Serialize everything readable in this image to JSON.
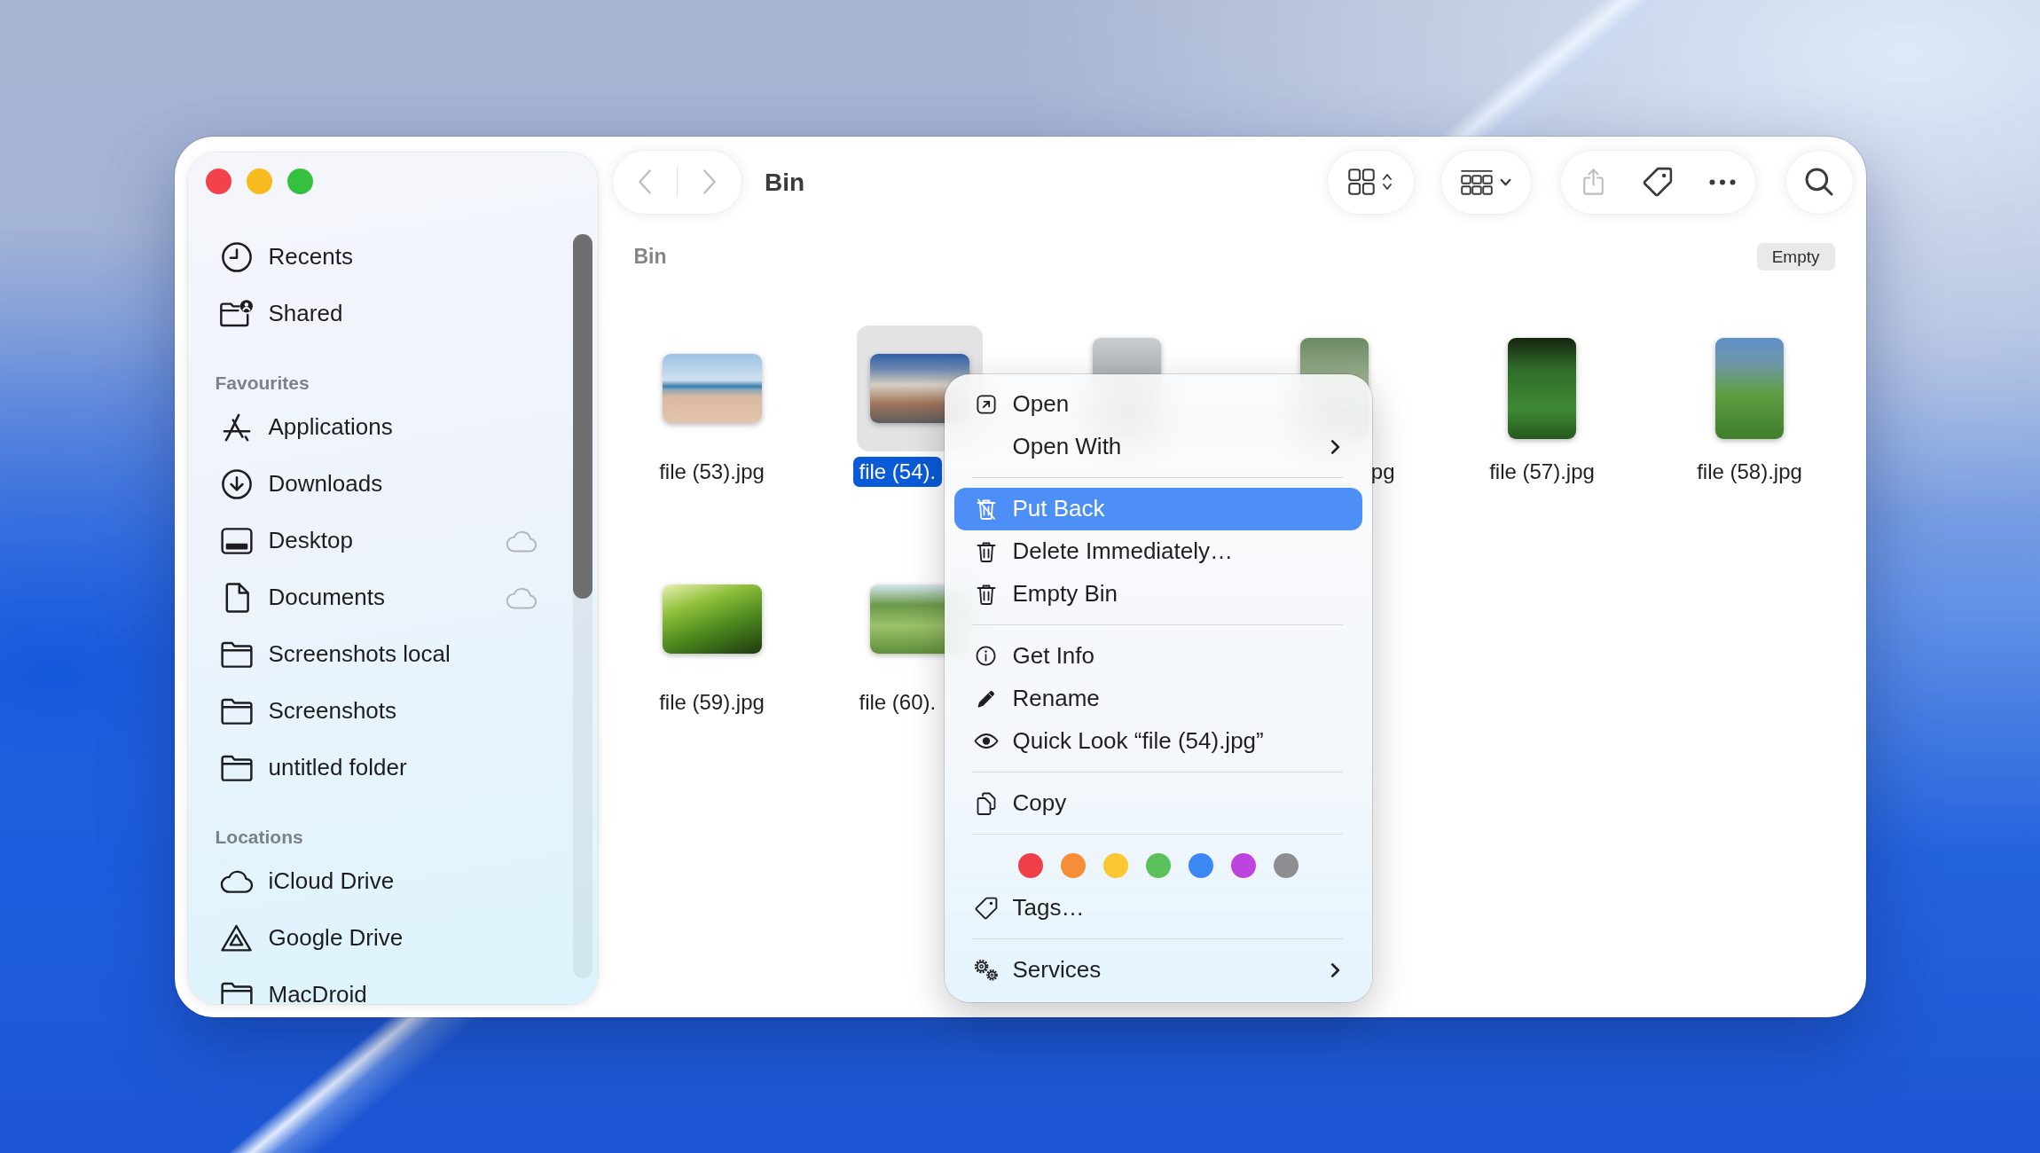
{
  "sidebar": {
    "groups": [
      {
        "items": [
          {
            "label": "Recents",
            "selected": false,
            "cloud": false
          },
          {
            "label": "Shared",
            "selected": false,
            "cloud": false
          }
        ]
      },
      {
        "heading": "Favourites",
        "items": [
          {
            "label": "Applications",
            "selected": false,
            "cloud": false
          },
          {
            "label": "Downloads",
            "selected": false,
            "cloud": false
          },
          {
            "label": "Desktop",
            "selected": false,
            "cloud": true
          },
          {
            "label": "Documents",
            "selected": false,
            "cloud": true
          },
          {
            "label": "Screenshots local",
            "selected": false,
            "cloud": false
          },
          {
            "label": "Screenshots",
            "selected": false,
            "cloud": false
          },
          {
            "label": "untitled folder",
            "selected": false,
            "cloud": false
          }
        ]
      },
      {
        "heading": "Locations",
        "items": [
          {
            "label": "iCloud Drive",
            "selected": false,
            "cloud": false
          },
          {
            "label": "Google Drive",
            "selected": false,
            "cloud": false
          },
          {
            "label": "MacDroid",
            "selected": false,
            "cloud": false
          }
        ]
      }
    ]
  },
  "toolbar": {
    "nav": [
      {
        "disabled": true
      },
      {
        "disabled": true
      }
    ],
    "title": "Bin",
    "tools": [
      {
        "disabled": false
      },
      {
        "disabled": false
      },
      {
        "disabled": true
      },
      {
        "disabled": false
      },
      {
        "disabled": false
      },
      {
        "disabled": false
      }
    ]
  },
  "path_bar": {
    "title": "Bin",
    "button": "Empty"
  },
  "files": [
    {
      "kind": "landscape",
      "label": "file (53).jpg",
      "cut_start": false,
      "cut_end": false,
      "selected": false
    },
    {
      "kind": "landscape",
      "label": "file (54).",
      "cut_start": false,
      "cut_end": true,
      "selected": true
    },
    {
      "kind": "portrait",
      "selected": false
    },
    {
      "kind": "portrait",
      "label": "pg",
      "cut_start": true,
      "cut_end": false,
      "selected": false
    },
    {
      "kind": "portrait",
      "label": "file (57).jpg",
      "cut_start": false,
      "cut_end": false,
      "selected": false
    },
    {
      "kind": "portrait",
      "label": "file (58).jpg",
      "cut_start": false,
      "cut_end": false,
      "selected": false
    },
    {
      "kind": "landscape",
      "label": "file (59).jpg",
      "cut_start": false,
      "cut_end": false,
      "selected": false
    },
    {
      "kind": "landscape",
      "label": "file (60).",
      "cut_start": false,
      "cut_end": true,
      "selected": false
    }
  ],
  "context_menu": {
    "items": [
      {
        "kind": "item",
        "label": "Open",
        "selected": false,
        "submenu": false
      },
      {
        "kind": "item",
        "label": "Open With",
        "selected": false,
        "submenu": true
      },
      {
        "kind": "separator"
      },
      {
        "kind": "item",
        "label": "Put Back",
        "selected": true,
        "submenu": false
      },
      {
        "kind": "item",
        "label": "Delete Immediately…",
        "selected": false,
        "submenu": false
      },
      {
        "kind": "item",
        "label": "Empty Bin",
        "selected": false,
        "submenu": false
      },
      {
        "kind": "separator"
      },
      {
        "kind": "item",
        "label": "Get Info",
        "selected": false,
        "submenu": false
      },
      {
        "kind": "item",
        "label": "Rename",
        "selected": false,
        "submenu": false
      },
      {
        "kind": "item",
        "label": "Quick Look “file (54).jpg”",
        "selected": false,
        "submenu": false
      },
      {
        "kind": "separator"
      },
      {
        "kind": "item",
        "label": "Copy",
        "selected": false,
        "submenu": false
      },
      {
        "kind": "separator"
      },
      {
        "kind": "tag_colors",
        "colors": [
          {
            "color": "#ef4049"
          },
          {
            "color": "#f68d37"
          },
          {
            "color": "#fcc730"
          },
          {
            "color": "#5bc25b"
          },
          {
            "color": "#3c87f6"
          },
          {
            "color": "#bd44df"
          },
          {
            "color": "#8e8e92"
          }
        ]
      },
      {
        "kind": "item",
        "label": "Tags…",
        "selected": false,
        "submenu": false
      },
      {
        "kind": "separator"
      },
      {
        "kind": "item",
        "label": "Services",
        "selected": false,
        "submenu": true
      }
    ]
  }
}
